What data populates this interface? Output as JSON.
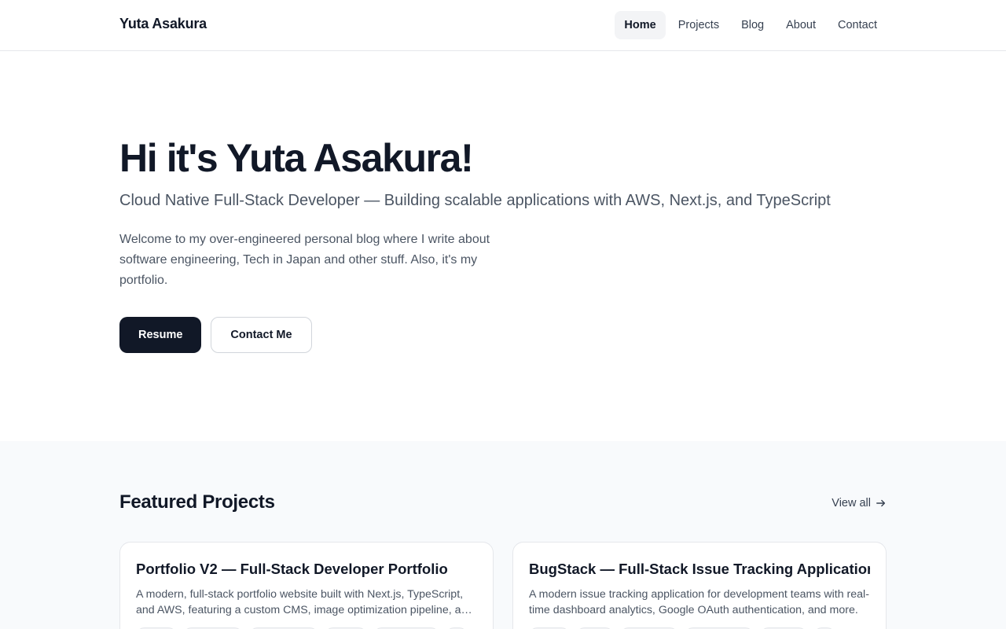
{
  "header": {
    "brand": "Yuta Asakura",
    "nav": [
      {
        "label": "Home",
        "active": true
      },
      {
        "label": "Projects",
        "active": false
      },
      {
        "label": "Blog",
        "active": false
      },
      {
        "label": "About",
        "active": false
      },
      {
        "label": "Contact",
        "active": false
      }
    ]
  },
  "hero": {
    "title": "Hi it's Yuta Asakura!",
    "subtitle": "Cloud Native Full-Stack Developer — Building scalable applications with AWS, Next.js, and TypeScript",
    "intro": "Welcome to my over-engineered personal blog where I write about software engineering, Tech in Japan and other stuff. Also, it's my portfolio.",
    "primary_button": "Resume",
    "secondary_button": "Contact Me"
  },
  "featured": {
    "title": "Featured Projects",
    "view_all": "View all",
    "arrow_icon": "arrow-right-icon",
    "projects": [
      {
        "title": "Portfolio V2 — Full-Stack Developer Portfolio",
        "description": "A modern, full-stack portfolio website built with Next.js, TypeScript, and AWS, featuring a custom CMS, image optimization pipeline, and more."
      },
      {
        "title": "BugStack — Full-Stack Issue Tracking Application",
        "description": "A modern issue tracking application for development teams with real-time dashboard analytics, Google OAuth authentication, and more."
      }
    ]
  },
  "colors": {
    "text_primary": "#111827",
    "text_secondary": "#4b5563",
    "primary_button_bg": "#111827",
    "section_bg": "#f8fafc",
    "border": "#e5e7eb"
  }
}
